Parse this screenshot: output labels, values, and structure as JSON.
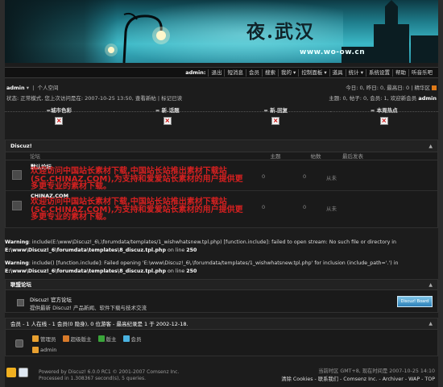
{
  "banner": {
    "title": "夜.武汉",
    "url": "www.wo-ow.cn"
  },
  "navbar": {
    "user": "admin:",
    "items": [
      "退出",
      "短消息",
      "会员",
      "搜索",
      "我的 ▾",
      "控制面板 ▾",
      "道具",
      "统计 ▾",
      "系统设置",
      "帮助",
      "听音乐吧"
    ]
  },
  "userbar": {
    "username": "admin",
    "caret": "▾",
    "space_link": "个人空间",
    "status_line": "状态: 正常模式, 您上次访问是在: 2007-10-25 13:50, 查看新帖 | 标记已读",
    "stats_line": "今日: 0, 昨日: 0, 最高日: 0 | 精华区",
    "members_prefix": "主题: 0, 帖子: 0, 会员: 1, 欢迎新会员 ",
    "newest_member": "admin"
  },
  "top_sections": {
    "headers": [
      "=城市色彩",
      "= 新.话题",
      "= 新.回复",
      "= 本周热点"
    ],
    "broken_image": "×"
  },
  "forum": {
    "title": "Discuz!",
    "collapse": "▲",
    "columns": [
      "论坛",
      "主题",
      "帖数",
      "最后发表"
    ],
    "rows": [
      {
        "name": "默认论坛",
        "desc": "欢迎访问中国站长素材下载,中国站长站推出素材下载站(SC.CHINAZ.COM),为支持和爱爱站长素材的用户提供更多更专业的素材下载。",
        "topics": "0",
        "posts": "0",
        "last": "从未"
      },
      {
        "name": "CHINAZ.COM",
        "desc": "欢迎访问中国站长素材下载,中国站长站推出素材下载站(SC.CHINAZ.COM),为支持和爱爱站长素材的用户提供更多更专业的素材下载。",
        "topics": "0",
        "posts": "0",
        "last": "从未"
      }
    ]
  },
  "warnings": [
    {
      "label": "Warning",
      "text": ": include(E:\\www\\Discuz!_6\\.\\forumdata/templates/1_wishwhatsnew.tpl.php) [function.include]: failed to open stream: No such file or directory in ",
      "file": "E:\\www\\Discuz!_6\\forumdata\\templates\\8_discuz.tpl.php",
      "line_prefix": " on line ",
      "line": "250"
    },
    {
      "label": "Warning",
      "text": ": include() [function.include]: Failed opening 'E:\\www\\Discuz!_6\\.\\forumdata/templates/1_wishwhatsnew.tpl.php' for inclusion (include_path='.') in ",
      "file": "E:\\www\\Discuz!_6\\forumdata\\templates\\8_discuz.tpl.php",
      "line_prefix": " on line ",
      "line": "250"
    }
  ],
  "links_block": {
    "title": "联盟论坛",
    "collapse": "▲",
    "name": "Discuz! 官方论坛",
    "desc": "提供最新 Discuz! 产品新闻、软件下载与技术交流",
    "banner_text": "Discuz! Board"
  },
  "online": {
    "title": "会员 - 1 人在线 - 1 会员(0 隐身), 0 位游客 - 最高纪录是 1 于 2002-12-18.",
    "collapse": "▲",
    "legend": [
      "管理员",
      "超级版主",
      "版主",
      "会员"
    ],
    "legend_colors": [
      "#e8a030",
      "#d87a2a",
      "#3aa53a",
      "#4ab2e0"
    ],
    "user": "admin"
  },
  "footer": {
    "powered_by": "Powered by Discuz! 6.0.0 RC1 © 2001-2007 Comsenz Inc.",
    "processed": "Processed in 1.308367 second(s), 5 queries.",
    "timezone": "当前时区 GMT+8, 现在时间是 2007-10-25 14:10",
    "links": "清除 Cookies - 联系我们 - Comsenz Inc. - Archiver - WAP - TOP"
  }
}
